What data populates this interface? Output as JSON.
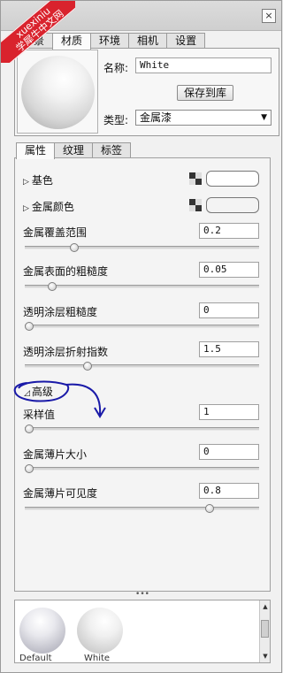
{
  "watermark": {
    "line1": "xuexiniu",
    "line2": "学犀牛中文网"
  },
  "window": {
    "close_glyph": "×"
  },
  "tabs": [
    {
      "label": "场景",
      "active": false
    },
    {
      "label": "材质",
      "active": true
    },
    {
      "label": "环境",
      "active": false
    },
    {
      "label": "相机",
      "active": false
    },
    {
      "label": "设置",
      "active": false
    }
  ],
  "material": {
    "name_label": "名称:",
    "name_value": "White",
    "save_button": "保存到库",
    "type_label": "类型:",
    "type_value": "金属漆"
  },
  "sub_tabs": [
    {
      "label": "属性",
      "active": true
    },
    {
      "label": "纹理",
      "active": false
    },
    {
      "label": "标签",
      "active": false
    }
  ],
  "properties": {
    "base_color": "基色",
    "metal_color": "金属颜色",
    "metal_coverage": {
      "label": "金属覆盖范围",
      "value": "0.2",
      "slider": 0.2
    },
    "metal_roughness": {
      "label": "金属表面的粗糙度",
      "value": "0.05",
      "slider": 0.1
    },
    "clearcoat_roughness": {
      "label": "透明涂层粗糙度",
      "value": "0",
      "slider": 0.0
    },
    "clearcoat_ior": {
      "label": "透明涂层折射指数",
      "value": "1.5",
      "slider": 0.26
    },
    "advanced": "高级",
    "sample_value": {
      "label": "采样值",
      "value": "1",
      "slider": 0.0
    },
    "flake_size": {
      "label": "金属薄片大小",
      "value": "0",
      "slider": 0.0
    },
    "flake_visibility": {
      "label": "金属薄片可见度",
      "value": "0.8",
      "slider": 0.8
    }
  },
  "library": {
    "items": [
      "Default",
      "White"
    ]
  },
  "icons": {
    "expand": "▷",
    "collapse": "◿",
    "dropdown": "▼",
    "splitter": "•••"
  }
}
